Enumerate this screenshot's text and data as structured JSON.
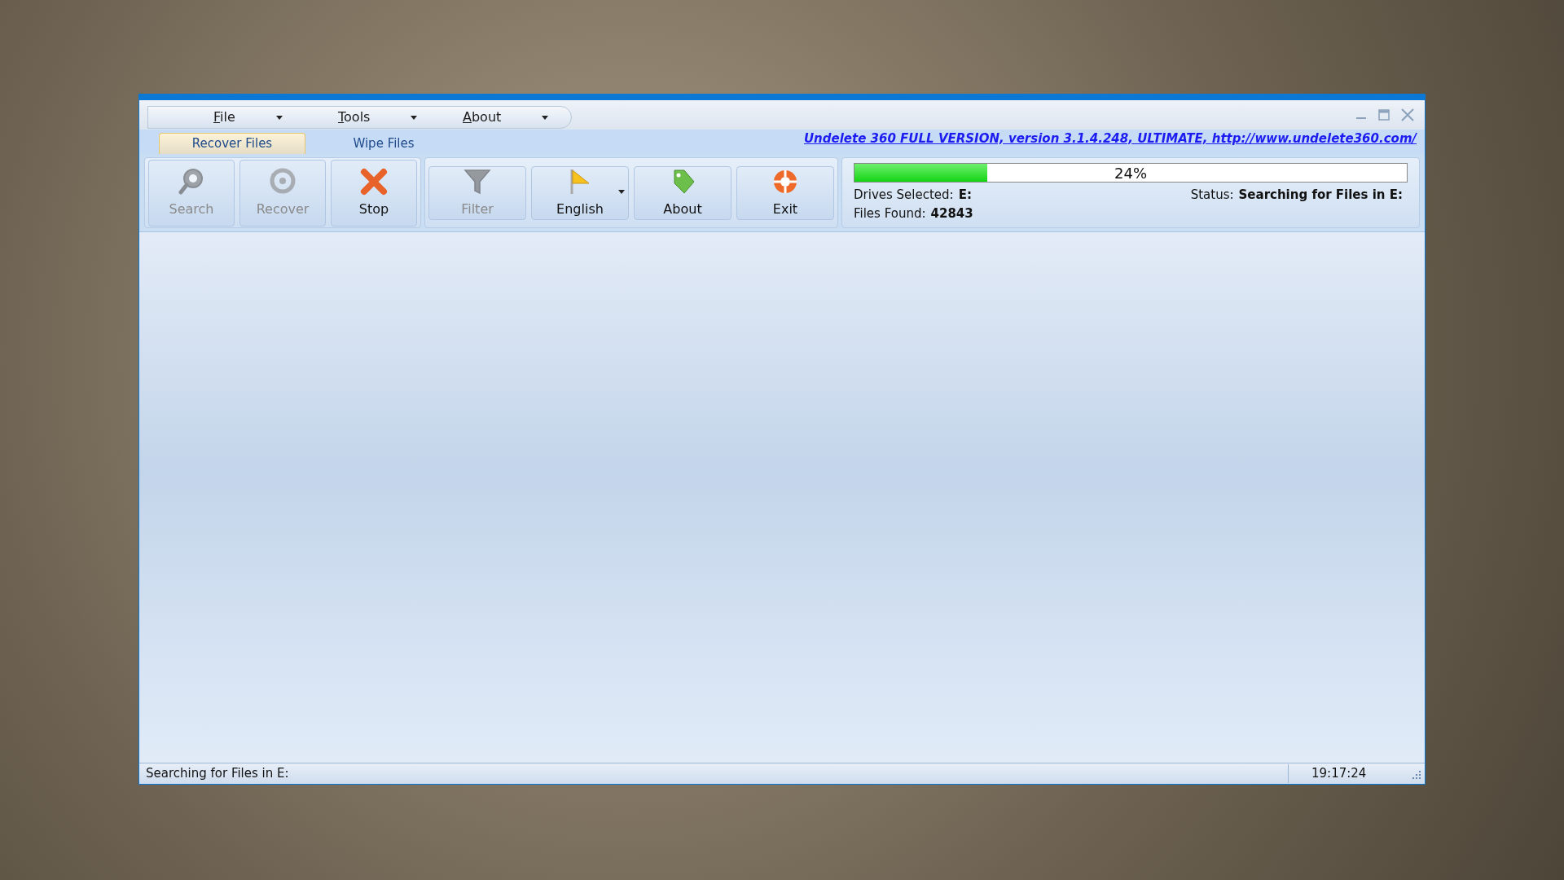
{
  "menu": [
    {
      "label": "File"
    },
    {
      "label": "Tools"
    },
    {
      "label": "About"
    }
  ],
  "tabs": [
    {
      "label": "Recover Files",
      "selected": true
    },
    {
      "label": "Wipe Files",
      "selected": false
    }
  ],
  "version_link": "Undelete 360 FULL VERSION, version 3.1.4.248, ULTIMATE, http://www.undelete360.com/",
  "toolbar_groups": [
    {
      "buttons": [
        {
          "label": "Search",
          "disabled": true,
          "kind": "plain"
        },
        {
          "label": "Recover",
          "disabled": true,
          "kind": "plain"
        },
        {
          "label": "Stop",
          "disabled": false,
          "kind": "plain"
        }
      ]
    },
    {
      "buttons": [
        {
          "label": "Filter",
          "disabled": true,
          "kind": "plain"
        },
        {
          "label": "English",
          "disabled": false,
          "kind": "split"
        },
        {
          "label": "About",
          "disabled": false,
          "kind": "plain"
        },
        {
          "label": "Exit",
          "disabled": false,
          "kind": "plain"
        }
      ]
    }
  ],
  "progress": {
    "level": 0.24,
    "reading": "24%"
  },
  "drives_selected": {
    "label": "Drives Selected:",
    "value": "E:"
  },
  "files_found": {
    "label": "Files Found:",
    "value": "42843"
  },
  "status": {
    "label": "Status:",
    "value": "Searching for Files in E:"
  },
  "status_bar": {
    "message": "Searching for Files in E:",
    "time": "19:17:24"
  }
}
